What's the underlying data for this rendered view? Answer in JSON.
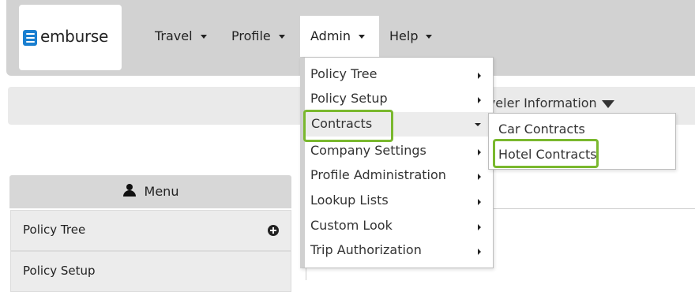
{
  "header": {
    "logo_text": "emburse",
    "nav": [
      {
        "label": "Travel"
      },
      {
        "label": "Profile"
      },
      {
        "label": "Admin"
      },
      {
        "label": "Help"
      }
    ]
  },
  "toolbar": {
    "traveler_info_label": "aveler Information"
  },
  "sidebar": {
    "menu_label": "Menu",
    "items": [
      {
        "label": "Policy Tree"
      },
      {
        "label": "Policy Setup"
      }
    ]
  },
  "admin_menu": {
    "items": [
      {
        "label": "Policy Tree"
      },
      {
        "label": "Policy Setup"
      },
      {
        "label": "Contracts"
      },
      {
        "label": "Company Settings"
      },
      {
        "label": "Profile Administration"
      },
      {
        "label": "Lookup Lists"
      },
      {
        "label": "Custom Look"
      },
      {
        "label": "Trip Authorization"
      }
    ]
  },
  "contracts_submenu": {
    "items": [
      {
        "label": "Car Contracts"
      },
      {
        "label": "Hotel Contracts"
      }
    ]
  },
  "colors": {
    "highlight_outline": "#7ab82e",
    "brand_blue": "#1a7fd0"
  }
}
